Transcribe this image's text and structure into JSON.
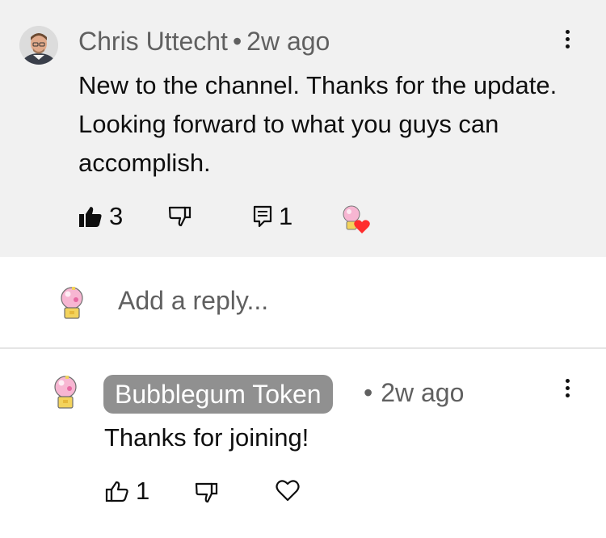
{
  "comment": {
    "author": "Chris Uttecht",
    "separator": "•",
    "time": "2w ago",
    "text": "New to the channel. Thanks for the update. Looking forward to what you guys can accomplish.",
    "likes": "3",
    "replies": "1"
  },
  "reply_box": {
    "placeholder": "Add a reply..."
  },
  "reply": {
    "author": "Bubblegum Token",
    "separator": "•",
    "time": "2w ago",
    "text": "Thanks for joining!",
    "likes": "1"
  },
  "colors": {
    "heart": "#ff2d2d",
    "creator_badge": "#909090",
    "thread_bg": "#f1f1f1"
  },
  "icons": [
    "avatar-photo",
    "thumbs-up-filled-icon",
    "thumbs-down-icon",
    "comment-icon",
    "creator-heart-icon",
    "more-vertical-icon",
    "thumbs-up-outline-icon",
    "heart-outline-icon",
    "gumball-avatar"
  ]
}
